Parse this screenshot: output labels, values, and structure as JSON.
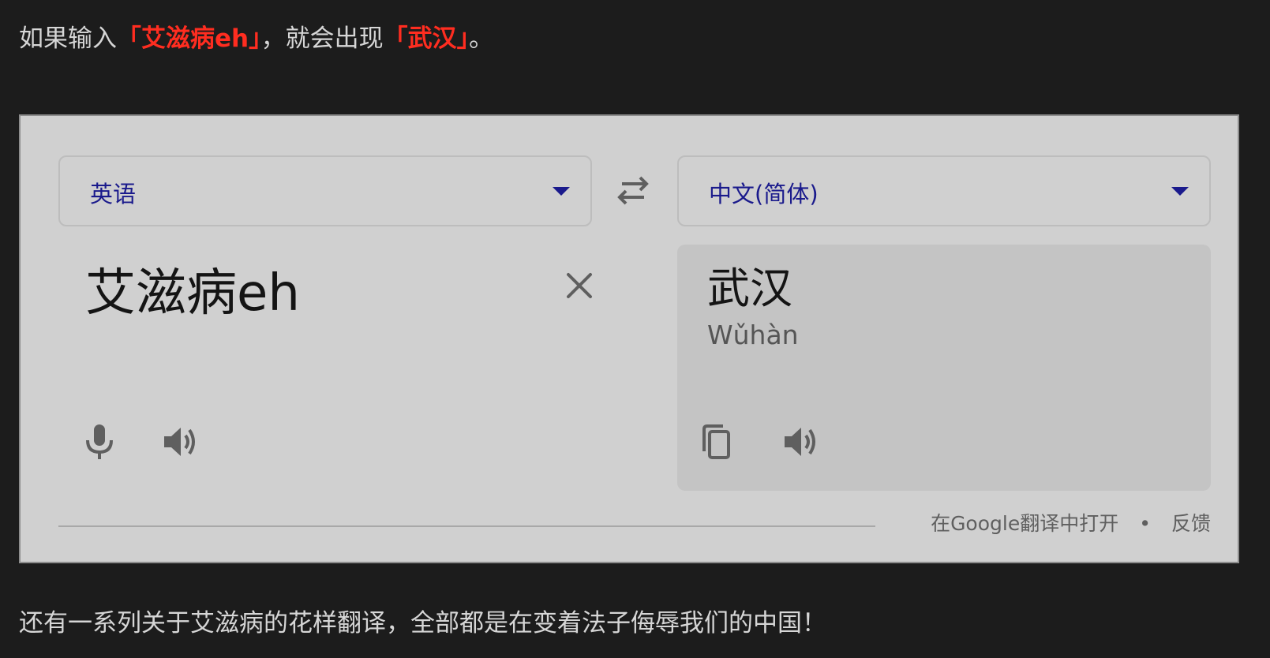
{
  "intro": {
    "prefix": "如果输入",
    "highlight_1": "「艾滋病eh」",
    "middle": "，就会出现",
    "highlight_2": "「武汉」",
    "suffix": "。"
  },
  "translator": {
    "source_language": "英语",
    "target_language": "中文(简体)",
    "source_text": "艾滋病eh",
    "translated_text": "武汉",
    "romanization": "Wǔhàn",
    "footer": {
      "open_link": "在Google翻译中打开",
      "separator": "•",
      "feedback_link": "反馈"
    },
    "icons": {
      "swap": "swap-arrows-icon",
      "clear": "close-icon",
      "mic": "microphone-icon",
      "speaker": "speaker-icon",
      "copy": "copy-icon"
    }
  },
  "outro": {
    "text": "还有一系列关于艾滋病的花样翻译，全部都是在变着法子侮辱我们的中国！"
  },
  "colors": {
    "page_background": "#1c1c1c",
    "highlight": "#ff2d20",
    "language_label": "#1a1a8c",
    "widget_background": "#d0d0d0",
    "result_panel": "#c4c4c4"
  }
}
